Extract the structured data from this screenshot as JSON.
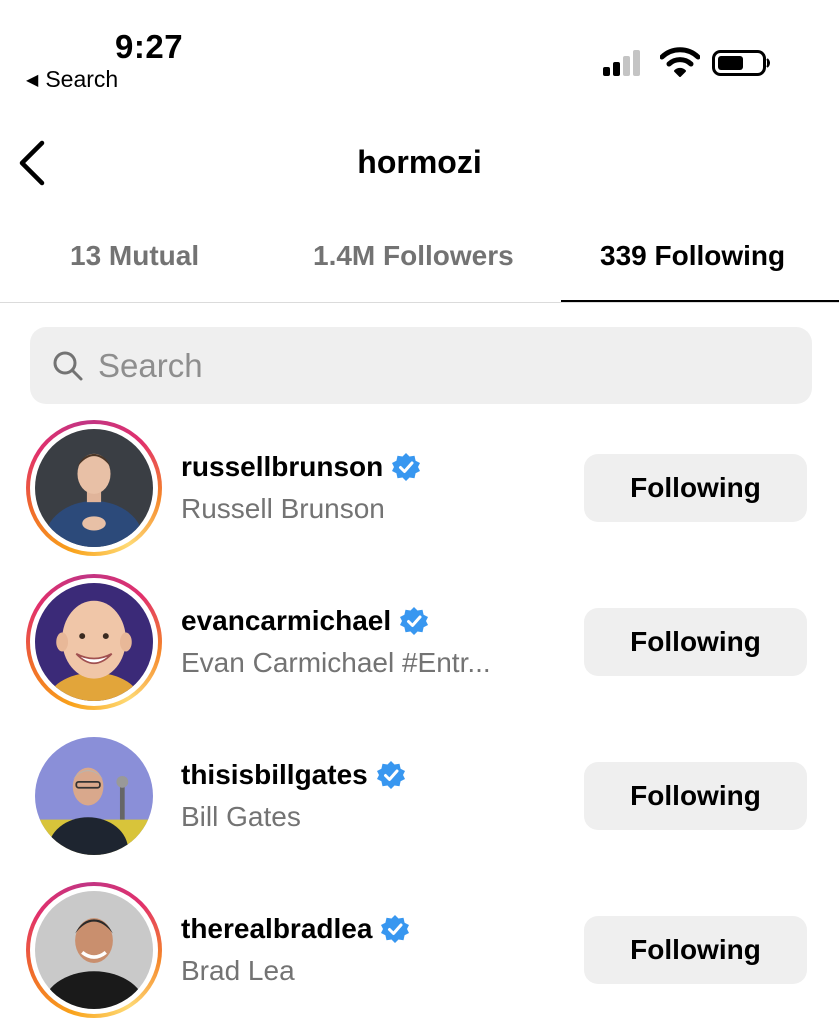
{
  "status_bar": {
    "time": "9:27",
    "back_app_label": "Search"
  },
  "header": {
    "title": "hormozi"
  },
  "tabs": [
    {
      "label": "13 Mutual",
      "active": false
    },
    {
      "label": "1.4M Followers",
      "active": false
    },
    {
      "label": "339 Following",
      "active": true
    }
  ],
  "search": {
    "placeholder": "Search",
    "value": ""
  },
  "accounts": [
    {
      "handle": "russellbrunson",
      "name": "Russell Brunson",
      "verified": true,
      "story_ring": true,
      "button": "Following"
    },
    {
      "handle": "evancarmichael",
      "name": "Evan Carmichael #Entr...",
      "verified": true,
      "story_ring": true,
      "button": "Following"
    },
    {
      "handle": "thisisbillgates",
      "name": "Bill Gates",
      "verified": true,
      "story_ring": false,
      "button": "Following"
    },
    {
      "handle": "therealbradlea",
      "name": "Brad Lea",
      "verified": true,
      "story_ring": true,
      "button": "Following"
    }
  ],
  "colors": {
    "verified_badge": "#3897f0",
    "muted_text": "#737373",
    "button_bg": "#efefef"
  },
  "icons": {
    "back": "chevron-left-icon",
    "search": "magnifier-icon",
    "verified": "verified-badge-icon"
  }
}
